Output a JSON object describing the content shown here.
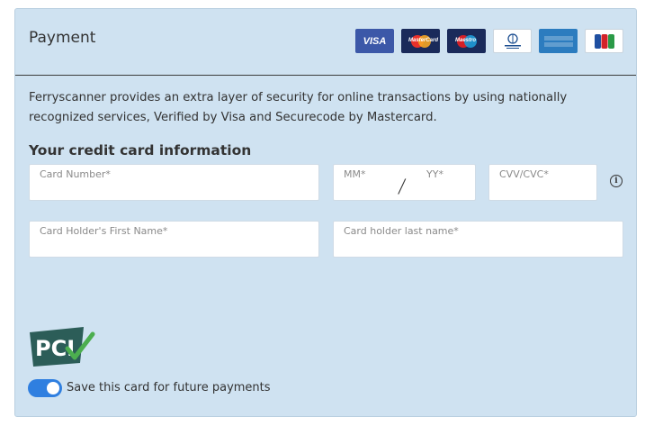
{
  "payment": {
    "title": "Payment",
    "card_logos": [
      {
        "name": "visa",
        "label": "VISA"
      },
      {
        "name": "mastercard",
        "label": "MasterCard"
      },
      {
        "name": "maestro",
        "label": "Maestro"
      },
      {
        "name": "diners-club",
        "label": "Diners Club International"
      },
      {
        "name": "american-express",
        "label": "AMERICAN EXPRESS"
      },
      {
        "name": "jcb",
        "label": "JCB"
      }
    ],
    "intro_text": "Ferryscanner provides an extra layer of security for online transactions by using nationally recognized services, Verified by Visa and Securecode by Mastercard.",
    "section_title": "Your credit card information",
    "fields": {
      "card_number": {
        "placeholder": "Card Number*",
        "value": ""
      },
      "expiry_month": {
        "placeholder": "MM*",
        "value": ""
      },
      "expiry_year": {
        "placeholder": "YY*",
        "value": ""
      },
      "cvv": {
        "placeholder": "CVV/CVC*",
        "value": ""
      },
      "first_name": {
        "placeholder": "Card Holder's First Name*",
        "value": ""
      },
      "last_name": {
        "placeholder": "Card holder last name*",
        "value": ""
      }
    },
    "expiry_separator": "/",
    "info_icon_glyph": "i",
    "pci_logo_text": "PCI",
    "save_card": {
      "label": "Save this card for future payments",
      "checked": true
    },
    "colors": {
      "panel_bg": "#cfe2f1",
      "toggle_on": "#2f7fe0",
      "pci_green": "#2e8a3e",
      "pci_dark": "#2c5d58"
    }
  }
}
